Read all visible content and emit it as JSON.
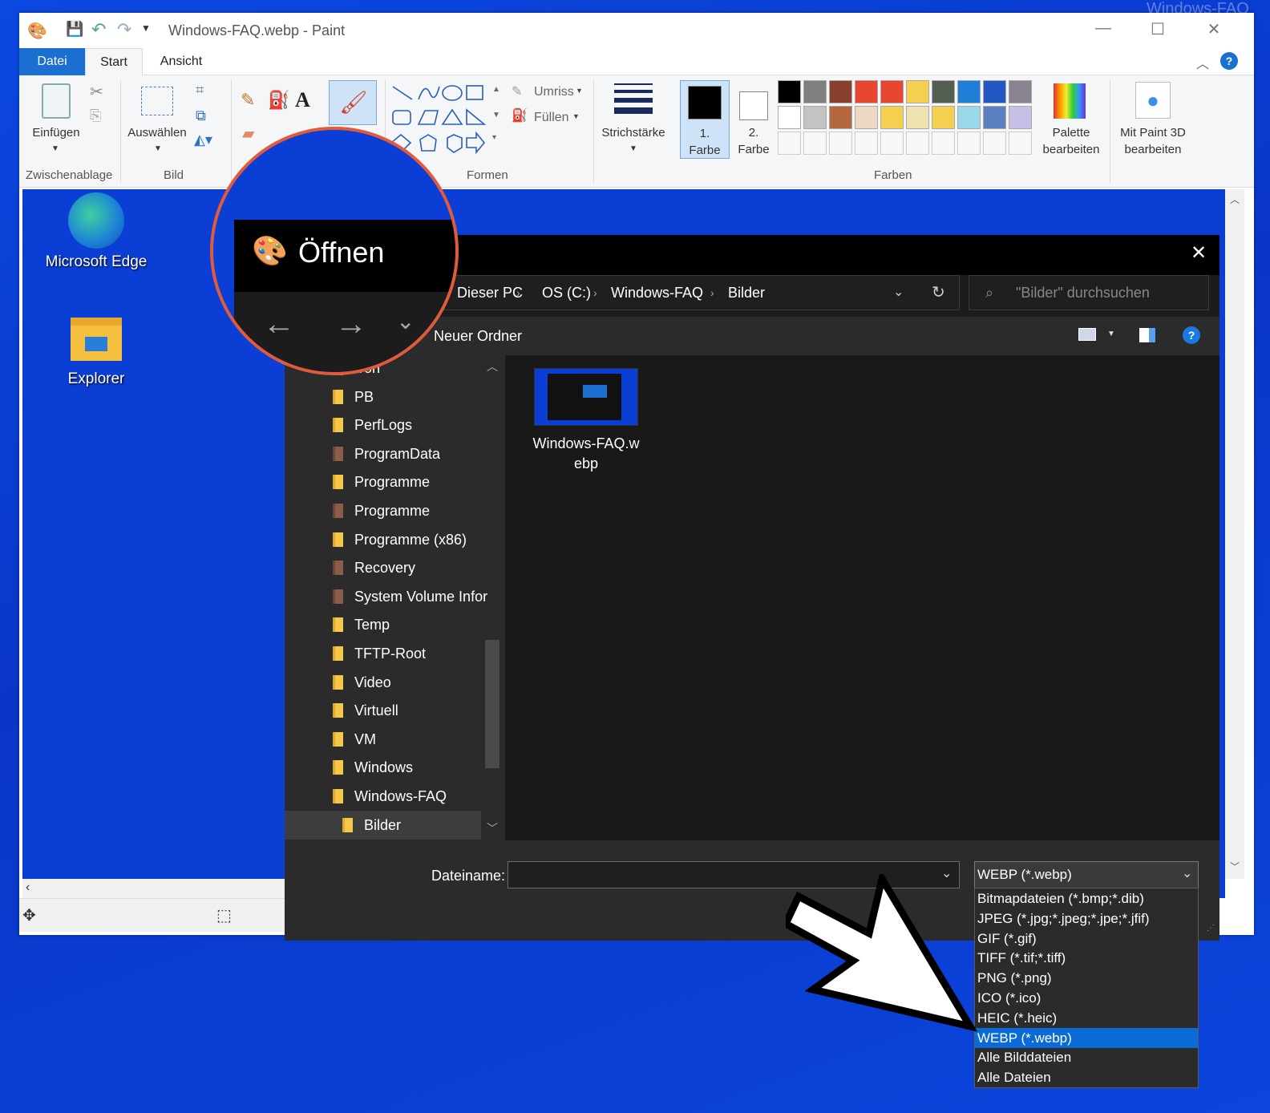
{
  "watermark": "Windows-FAQ",
  "paint": {
    "title": "Windows-FAQ.webp - Paint",
    "tabs": {
      "file": "Datei",
      "start": "Start",
      "view": "Ansicht"
    },
    "ribbon": {
      "paste": "Einfügen",
      "select": "Auswählen",
      "outline": "Umriss",
      "fill": "Füllen",
      "stroke": "Strichstärke",
      "color1": "1.\nFarbe",
      "color1_a": "1.",
      "color1_b": "Farbe",
      "color2_a": "2.",
      "color2_b": "Farbe",
      "edit_palette_a": "Palette",
      "edit_palette_b": "bearbeiten",
      "paint3d_a": "Mit Paint 3D",
      "paint3d_b": "bearbeiten",
      "groups": {
        "clipboard": "Zwischenablage",
        "image": "Bild",
        "shapes": "Formen",
        "colors": "Farben"
      }
    },
    "palette_row1": [
      "#000000",
      "#7f7f7f",
      "#88402c",
      "#e8452e",
      "#e8452e",
      "#f5d04e",
      "#555e52",
      "#1f7fd8",
      "#2357c4",
      "#8a8490"
    ],
    "palette_row2": [
      "#ffffff",
      "#c3c3c3",
      "#b5673f",
      "#efd9c4",
      "#f5d04e",
      "#efe4b0",
      "#f5d04e",
      "#99d9ea",
      "#5c7fc0",
      "#c8bfe7"
    ]
  },
  "desktop": {
    "edge": "Microsoft Edge",
    "explorer": "Explorer"
  },
  "dialog": {
    "title": "Öffnen",
    "breadcrumb": [
      "Dieser PC",
      "OS (C:)",
      "Windows-FAQ",
      "Bilder"
    ],
    "search_placeholder": "\"Bilder\" durchsuchen",
    "new_folder": "Neuer Ordner",
    "nav_items": [
      {
        "label": "rron",
        "type": "folder"
      },
      {
        "label": "PB",
        "type": "folder"
      },
      {
        "label": "PerfLogs",
        "type": "folder"
      },
      {
        "label": "ProgramData",
        "type": "system"
      },
      {
        "label": "Programme",
        "type": "folder"
      },
      {
        "label": "Programme",
        "type": "system"
      },
      {
        "label": "Programme (x86)",
        "type": "folder"
      },
      {
        "label": "Recovery",
        "type": "system"
      },
      {
        "label": "System Volume Infor",
        "type": "system"
      },
      {
        "label": "Temp",
        "type": "folder"
      },
      {
        "label": "TFTP-Root",
        "type": "folder"
      },
      {
        "label": "Video",
        "type": "folder"
      },
      {
        "label": "Virtuell",
        "type": "folder"
      },
      {
        "label": "VM",
        "type": "folder"
      },
      {
        "label": "Windows",
        "type": "folder"
      },
      {
        "label": "Windows-FAQ",
        "type": "folder"
      },
      {
        "label": "Bilder",
        "type": "folder"
      }
    ],
    "file_name_a": "Windows-FAQ.w",
    "file_name_b": "ebp",
    "filename_label": "Dateiname:",
    "filename_value": "",
    "filetype_selected": "WEBP (*.webp)",
    "filetype_options": [
      "Bitmapdateien (*.bmp;*.dib)",
      "JPEG (*.jpg;*.jpeg;*.jpe;*.jfif)",
      "GIF (*.gif)",
      "TIFF (*.tif;*.tiff)",
      "PNG (*.png)",
      "ICO (*.ico)",
      "HEIC (*.heic)",
      "WEBP (*.webp)",
      "Alle Bilddateien",
      "Alle Dateien"
    ]
  }
}
